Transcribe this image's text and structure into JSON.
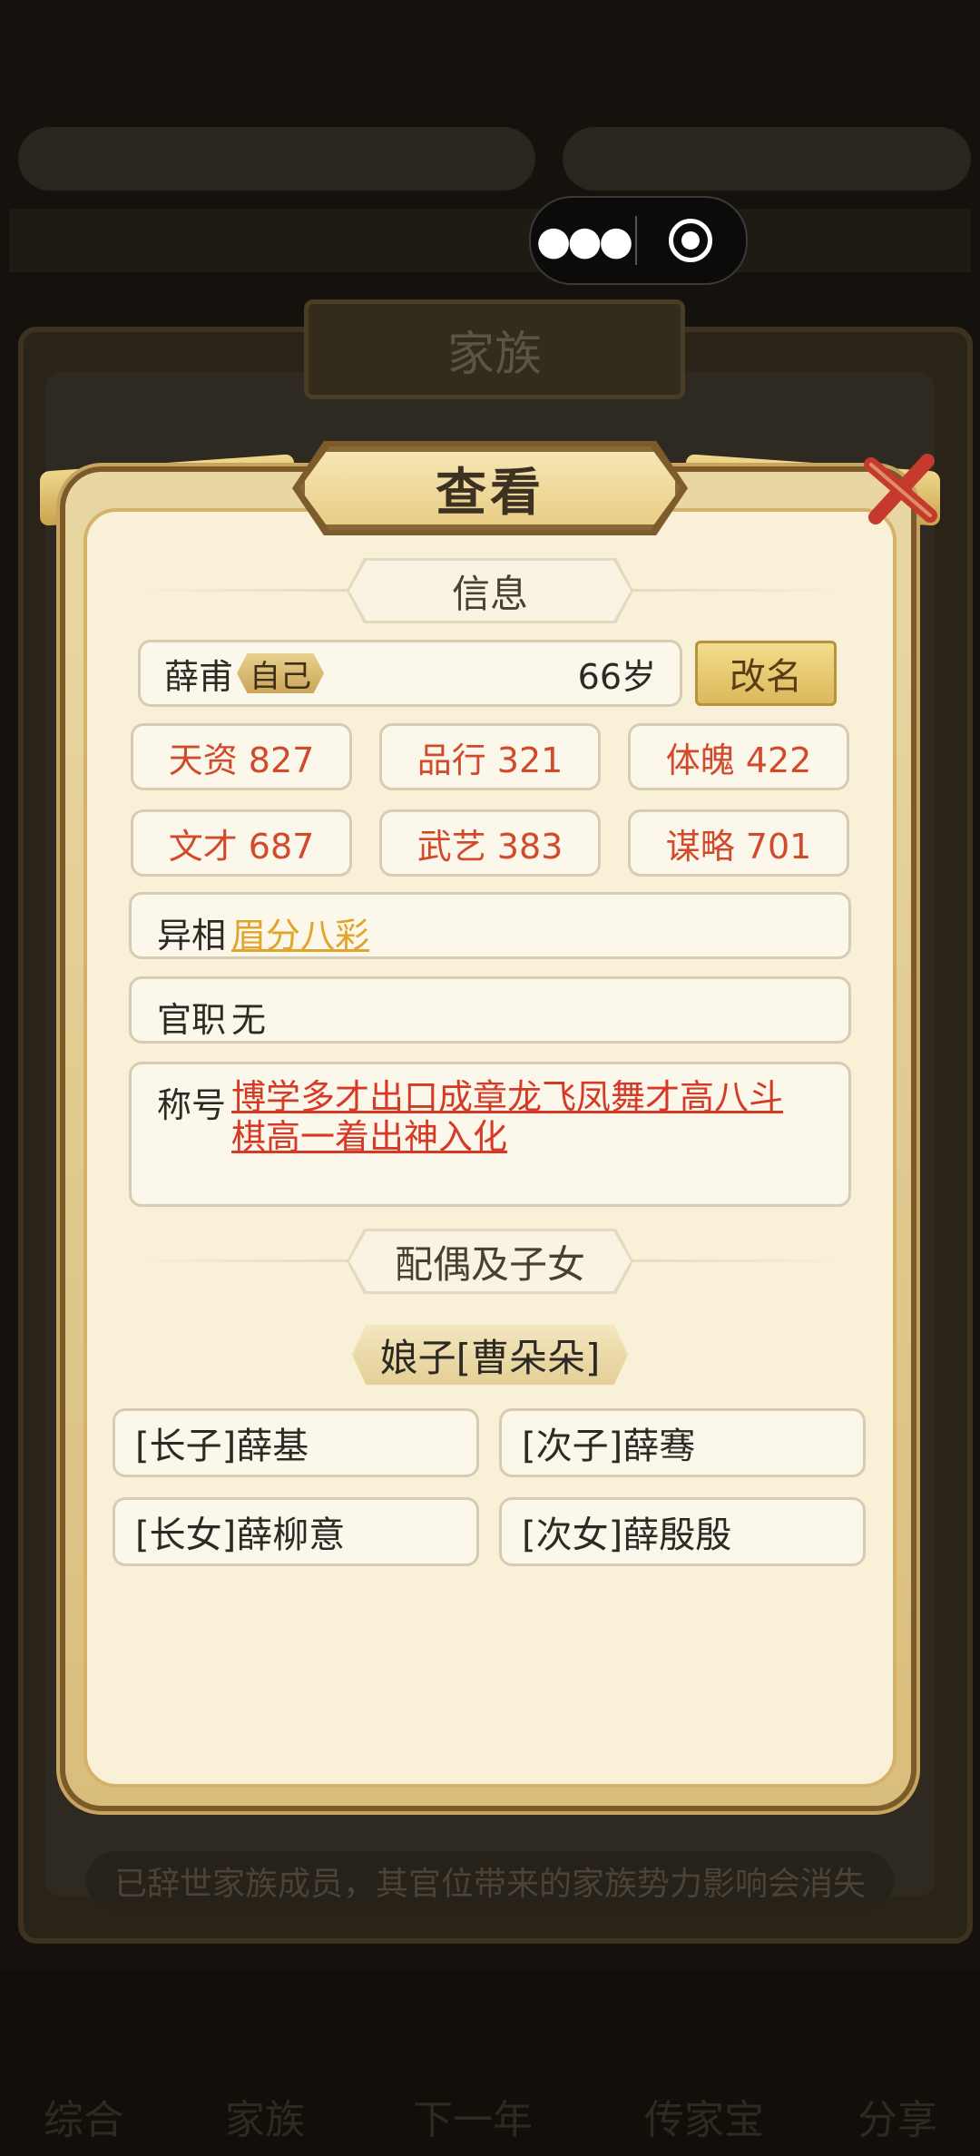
{
  "background": {
    "family_title": "家族",
    "notice": "已辞世家族成员，其官位带来的家族势力影响会消失",
    "nav": [
      "综合",
      "家族",
      "下一年",
      "传家宝",
      "分享"
    ]
  },
  "capsule": {
    "more_icon": "more-dots-icon",
    "close_icon": "target-close-icon"
  },
  "modal": {
    "title": "查看",
    "info_section": "信息",
    "name": "薛甫",
    "self_tag": "自己",
    "age": "66岁",
    "rename_button": "改名",
    "stats": [
      {
        "label": "天资 827"
      },
      {
        "label": "品行 321"
      },
      {
        "label": "体魄 422"
      },
      {
        "label": "文才 687"
      },
      {
        "label": "武艺 383"
      },
      {
        "label": "谋略 701"
      }
    ],
    "trait_label": "异相",
    "trait_value": "眉分八彩",
    "office_label": "官职",
    "office_value": "无",
    "titles_label": "称号",
    "titles_line1": "博学多才出口成章龙飞凤舞才高八斗",
    "titles_line2": "棋高一着出神入化",
    "family_section": "配偶及子女",
    "spouse": "娘子[曹朵朵]",
    "children": [
      "[长子]薛基",
      "[次子]薛骞",
      "[长女]薛柳意",
      "[次女]薛殷殷"
    ]
  }
}
